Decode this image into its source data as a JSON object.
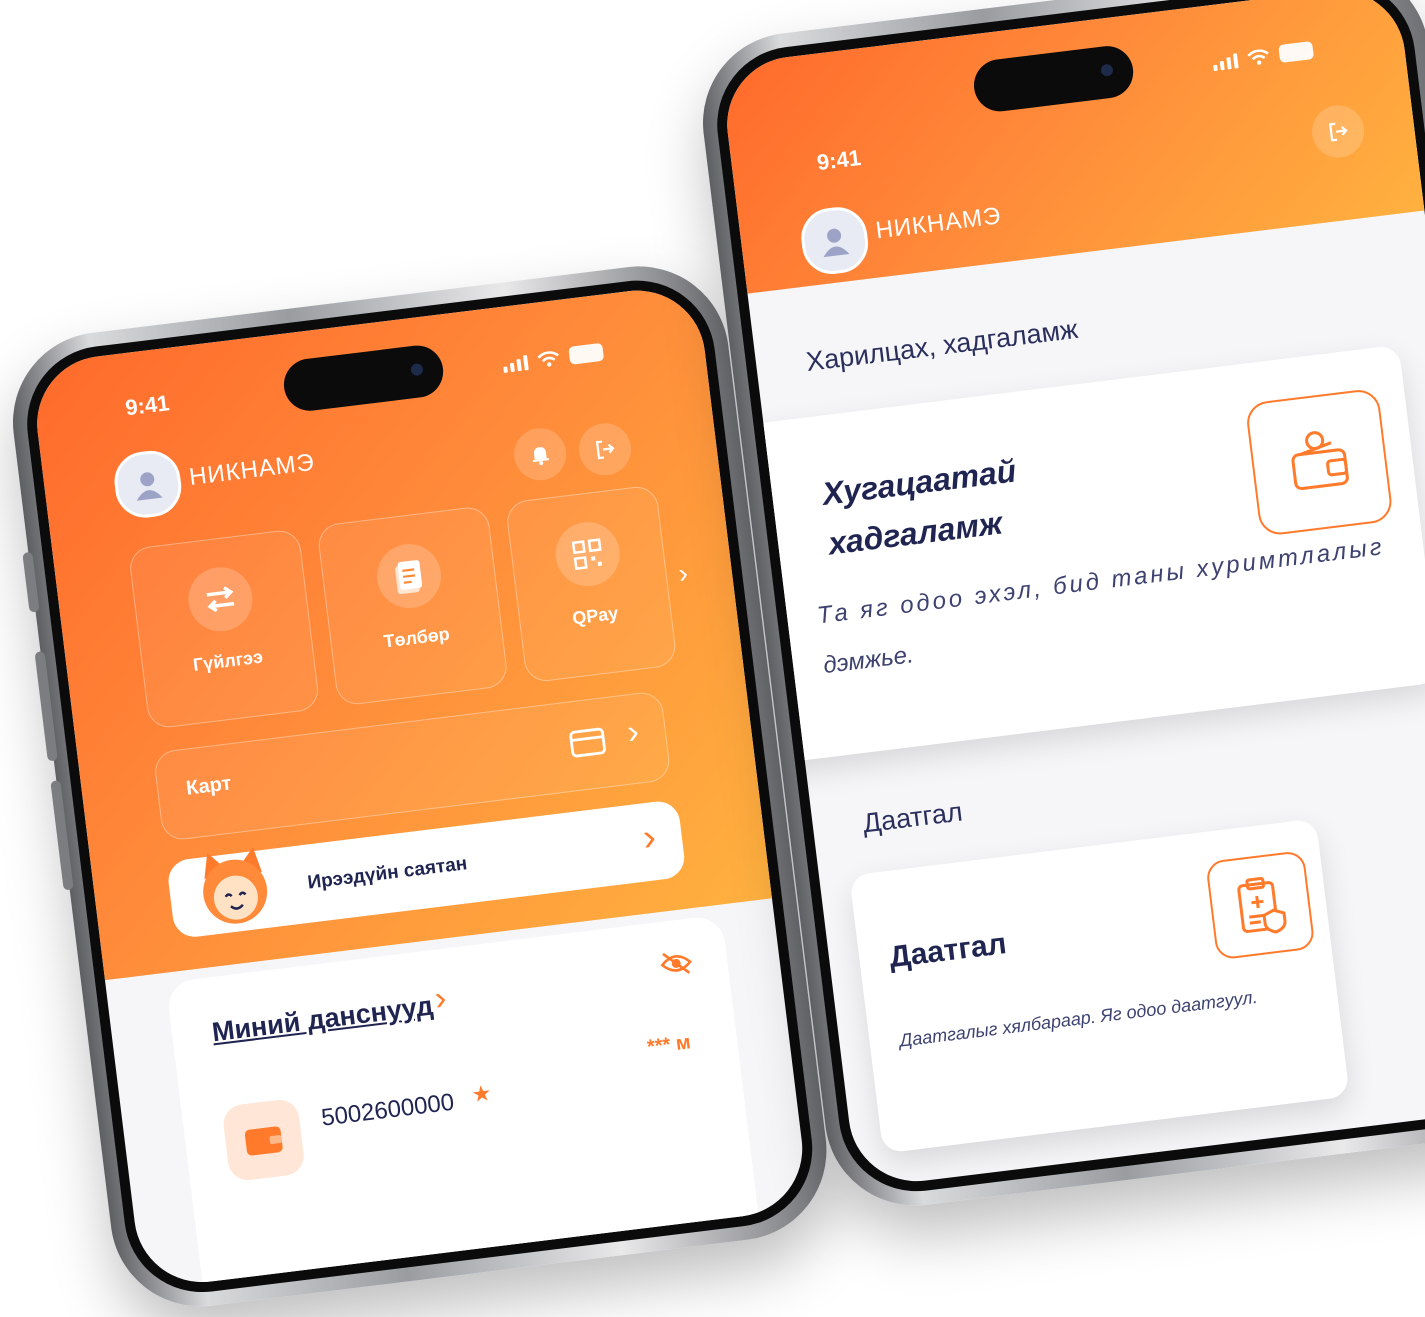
{
  "left_phone": {
    "status": {
      "time": "9:41"
    },
    "header": {
      "nickname": "НИКНАМЭ"
    },
    "quick_actions": [
      {
        "label": "Гүйлгээ",
        "icon": "transfer-arrows-icon"
      },
      {
        "label": "Төлбөр",
        "icon": "bill-icon"
      },
      {
        "label": "QPay",
        "icon": "qr-code-icon"
      }
    ],
    "card_row": {
      "label": "Карт"
    },
    "savings_banner": {
      "label": "Ирээдүйн саятан"
    },
    "accounts": {
      "title": "Миний данснууд",
      "account_number": "5002600000",
      "masked_balance": "*** м"
    }
  },
  "right_phone": {
    "status": {
      "time": "9:41"
    },
    "header": {
      "nickname": "НИКНАМЭ"
    },
    "sections": [
      {
        "title": "Харилцах, хадгаламж",
        "card_title_line1": "Хугацаатай",
        "card_title_line2": "хадгаламж",
        "card_desc_line1": "Та яг одоо эхэл, бид таны хуримтлалыг",
        "card_desc_line2": "дэмжье."
      },
      {
        "title": "Даатгал",
        "card_title": "Даатгал",
        "card_desc": "Даатгалыг хялбараар. Яг одоо даатгуул."
      }
    ]
  },
  "colors": {
    "accent": "#ff7a2a",
    "navy": "#1f2450",
    "gradient_start": "#ff6a2b",
    "gradient_end": "#ffb13f"
  }
}
